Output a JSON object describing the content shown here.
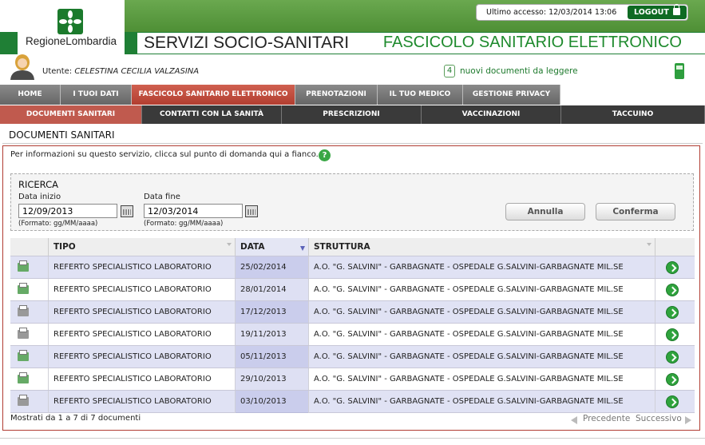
{
  "header": {
    "logo_text": "RegioneLombardia",
    "title_left": "SERVIZI SOCIO-SANITARI",
    "title_right": "FASCICOLO SANITARIO ELETTRONICO",
    "last_access": "Ultimo accesso: 12/03/2014 13:06",
    "logout_label": "LOGOUT"
  },
  "user": {
    "label": "Utente:",
    "name": "CELESTINA CECILIA VALZASINA",
    "new_docs_count": "4",
    "new_docs_text": "nuovi documenti da leggere"
  },
  "nav_primary": [
    {
      "label": "HOME"
    },
    {
      "label": "I TUOI DATI"
    },
    {
      "label": "FASCICOLO SANITARIO ELETTRONICO",
      "active": true
    },
    {
      "label": "PRENOTAZIONI"
    },
    {
      "label": "IL TUO MEDICO"
    },
    {
      "label": "GESTIONE PRIVACY"
    }
  ],
  "nav_secondary": [
    {
      "label": "DOCUMENTI SANITARI",
      "active": true
    },
    {
      "label": "CONTATTI CON LA SANITÀ"
    },
    {
      "label": "PRESCRIZIONI"
    },
    {
      "label": "VACCINAZIONI"
    },
    {
      "label": "TACCUINO"
    }
  ],
  "page": {
    "section_title": "DOCUMENTI SANITARI",
    "info_text": "Per informazioni su questo servizio, clicca sul punto di domanda qui a fianco."
  },
  "search": {
    "title": "RICERCA",
    "start_label": "Data inizio",
    "start_value": "12/09/2013",
    "end_label": "Data fine",
    "end_value": "12/03/2014",
    "format_hint": "(Formato: gg/MM/aaaa)",
    "cancel_label": "Annulla",
    "confirm_label": "Conferma"
  },
  "table": {
    "columns": [
      "",
      "TIPO",
      "DATA",
      "STRUTTURA",
      ""
    ],
    "rows": [
      {
        "tipo": "REFERTO SPECIALISTICO LABORATORIO",
        "data": "25/02/2014",
        "struttura": "A.O. \"G. SALVINI\" - GARBAGNATE - OSPEDALE G.SALVINI-GARBAGNATE MIL.SE",
        "new": true
      },
      {
        "tipo": "REFERTO SPECIALISTICO LABORATORIO",
        "data": "28/01/2014",
        "struttura": "A.O. \"G. SALVINI\" - GARBAGNATE - OSPEDALE G.SALVINI-GARBAGNATE MIL.SE",
        "new": true
      },
      {
        "tipo": "REFERTO SPECIALISTICO LABORATORIO",
        "data": "17/12/2013",
        "struttura": "A.O. \"G. SALVINI\" - GARBAGNATE - OSPEDALE G.SALVINI-GARBAGNATE MIL.SE",
        "new": false
      },
      {
        "tipo": "REFERTO SPECIALISTICO LABORATORIO",
        "data": "19/11/2013",
        "struttura": "A.O. \"G. SALVINI\" - GARBAGNATE - OSPEDALE G.SALVINI-GARBAGNATE MIL.SE",
        "new": false
      },
      {
        "tipo": "REFERTO SPECIALISTICO LABORATORIO",
        "data": "05/11/2013",
        "struttura": "A.O. \"G. SALVINI\" - GARBAGNATE - OSPEDALE G.SALVINI-GARBAGNATE MIL.SE",
        "new": true
      },
      {
        "tipo": "REFERTO SPECIALISTICO LABORATORIO",
        "data": "29/10/2013",
        "struttura": "A.O. \"G. SALVINI\" - GARBAGNATE - OSPEDALE G.SALVINI-GARBAGNATE MIL.SE",
        "new": true
      },
      {
        "tipo": "REFERTO SPECIALISTICO LABORATORIO",
        "data": "03/10/2013",
        "struttura": "A.O. \"G. SALVINI\" - GARBAGNATE - OSPEDALE G.SALVINI-GARBAGNATE MIL.SE",
        "new": false
      }
    ],
    "count_text": "Mostrati da 1 a 7 di 7 documenti",
    "prev_label": "Precedente",
    "next_label": "Successivo"
  },
  "colors": {
    "brand_green": "#1f7f35",
    "active_tab_red": "#b23e30",
    "row_highlight": "#e0e2f4"
  }
}
